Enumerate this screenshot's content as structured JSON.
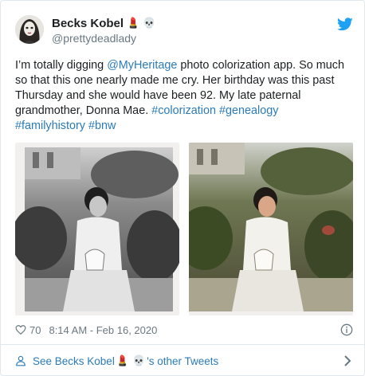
{
  "tweet": {
    "author_name": "Becks Kobel",
    "author_emojis": [
      "💄",
      "💀"
    ],
    "handle": "@prettydeadlady",
    "text_segments": [
      {
        "text": "I’m totally digging ",
        "link": false
      },
      {
        "text": "@MyHeritage",
        "link": true
      },
      {
        "text": " photo colorization app. So much so that this one nearly made me cry. Her birthday was this past Thursday and she would have been 92. My late paternal grandmother, Donna Mae. ",
        "link": false
      },
      {
        "text": "#colorization",
        "link": true
      },
      {
        "text": " ",
        "link": false
      },
      {
        "text": "#genealogy",
        "link": true
      },
      {
        "text": " ",
        "link": false
      },
      {
        "text": "#familyhistory",
        "link": true
      },
      {
        "text": " ",
        "link": false
      },
      {
        "text": "#bnw",
        "link": true
      }
    ],
    "likes": "70",
    "timestamp": "8:14 AM - Feb 16, 2020"
  },
  "footer": {
    "prefix": "See Becks Kobel",
    "suffix": "'s other Tweets",
    "emojis": [
      "💄",
      "💀"
    ]
  },
  "colors": {
    "link": "#2b7bb9",
    "twitter_blue": "#1da1f2",
    "muted": "#697882",
    "heart": "#697882",
    "divider": "#e1e8ed"
  },
  "icons": {
    "bird": "twitter-bird-icon",
    "heart": "heart-outline-icon",
    "info": "info-circle-icon",
    "person": "person-icon",
    "chevron": "chevron-right-icon"
  }
}
